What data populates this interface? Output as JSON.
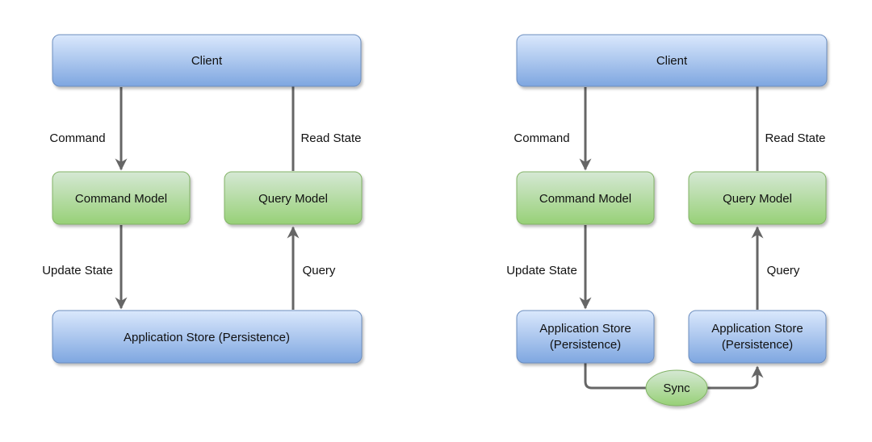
{
  "colors": {
    "blue_top": "#dae8fc",
    "blue_bottom": "#7ea6e0",
    "blue_stroke": "#6c8ebf",
    "green_top": "#d5e8d4",
    "green_bottom": "#97d077",
    "green_stroke": "#82b366",
    "arrow": "#666666"
  },
  "left": {
    "client": "Client",
    "command_model": "Command Model",
    "query_model": "Query Model",
    "store": "Application Store (Persistence)",
    "edge_command": "Command",
    "edge_read_state": "Read State",
    "edge_update_state": "Update State",
    "edge_query": "Query"
  },
  "right": {
    "client": "Client",
    "command_model": "Command Model",
    "query_model": "Query Model",
    "store_write_line1": "Application Store",
    "store_write_line2": "(Persistence)",
    "store_read_line1": "Application Store",
    "store_read_line2": "(Persistence)",
    "sync": "Sync",
    "edge_command": "Command",
    "edge_read_state": "Read State",
    "edge_update_state": "Update State",
    "edge_query": "Query"
  }
}
